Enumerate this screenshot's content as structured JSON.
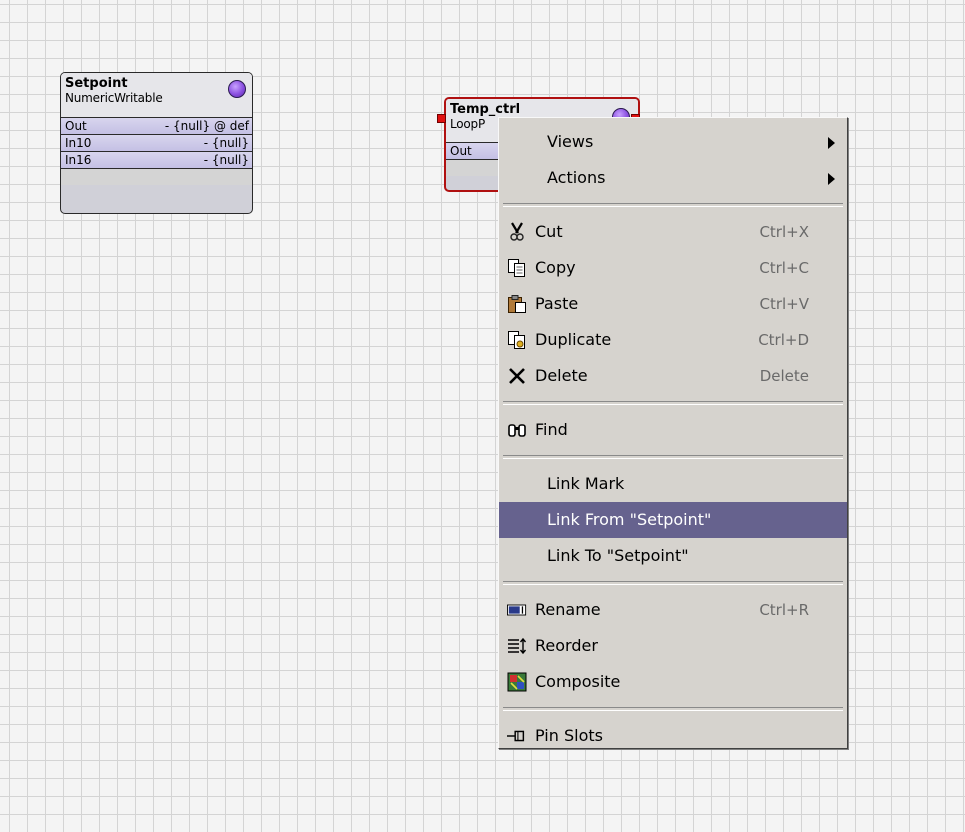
{
  "setpoint": {
    "name": "Setpoint",
    "type": "NumericWritable",
    "slots": [
      {
        "name": "Out",
        "value": "- {null} @ def"
      },
      {
        "name": "In10",
        "value": "- {null}"
      },
      {
        "name": "In16",
        "value": "- {null}"
      }
    ]
  },
  "temp_ctrl": {
    "name": "Temp_ctrl",
    "type": "LoopP",
    "slots": [
      {
        "name": "Out"
      }
    ]
  },
  "context_menu": {
    "views": {
      "label": "Views"
    },
    "actions": {
      "label": "Actions"
    },
    "cut": {
      "label": "Cut",
      "shortcut": "Ctrl+X",
      "icon": "scissors-icon"
    },
    "copy": {
      "label": "Copy",
      "shortcut": "Ctrl+C",
      "icon": "copy-icon"
    },
    "paste": {
      "label": "Paste",
      "shortcut": "Ctrl+V",
      "icon": "paste-icon"
    },
    "duplicate": {
      "label": "Duplicate",
      "shortcut": "Ctrl+D",
      "icon": "duplicate-icon"
    },
    "delete": {
      "label": "Delete",
      "shortcut": "Delete",
      "icon": "x-icon"
    },
    "find": {
      "label": "Find",
      "icon": "binoculars-icon"
    },
    "link_mark": {
      "label": "Link Mark"
    },
    "link_from": {
      "label": "Link From \"Setpoint\"",
      "highlighted": true
    },
    "link_to": {
      "label": "Link To \"Setpoint\""
    },
    "rename": {
      "label": "Rename",
      "shortcut": "Ctrl+R",
      "icon": "rename-icon"
    },
    "reorder": {
      "label": "Reorder",
      "icon": "reorder-icon"
    },
    "composite": {
      "label": "Composite",
      "icon": "composite-icon"
    },
    "pin_slots": {
      "label": "Pin Slots",
      "icon": "pin-icon"
    }
  },
  "colors": {
    "highlight": "#66628e",
    "selection": "#b01010",
    "status_dot": "#8a4fe0",
    "slot_fill": "#c4c0e4"
  }
}
